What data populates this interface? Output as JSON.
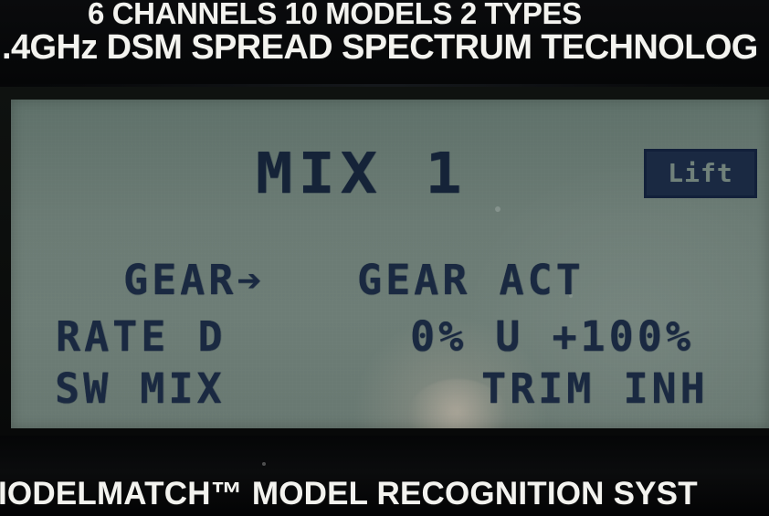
{
  "device": {
    "header_line_1": "6 CHANNELS  10 MODELS  2 TYPES",
    "header_line_2": ".4GHz DSM SPREAD SPECTRUM TECHNOLOG",
    "footer_line": "IODELMATCH™ MODEL RECOGNITION SYST"
  },
  "lcd": {
    "title": "MIX 1",
    "badge": "Lift",
    "rows": [
      {
        "left": "GEAR➔",
        "right": "GEAR ACT"
      },
      {
        "left": "RATE D",
        "right": "0% U +100%"
      },
      {
        "left": "SW MIX",
        "right": "TRIM INH"
      }
    ]
  },
  "colors": {
    "lcd_background": "#6b7b74",
    "lcd_text": "#152338",
    "label_text": "#f3f3ef",
    "bezel": "#050607"
  }
}
